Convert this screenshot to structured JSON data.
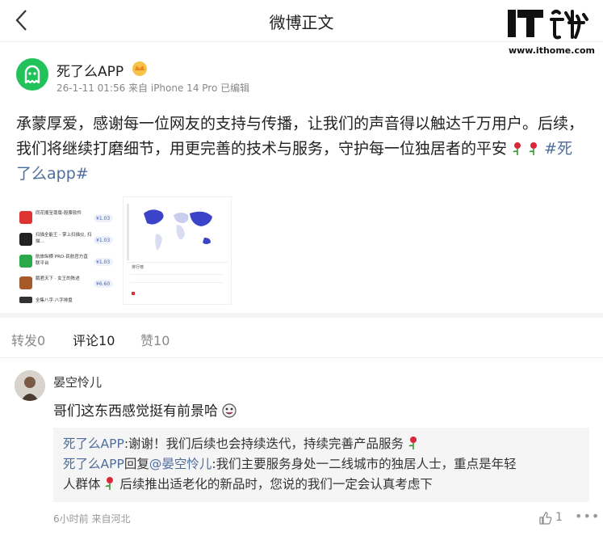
{
  "header": {
    "title": "微博正文",
    "brand_text": "IT之家",
    "brand_url": "www.ithome.com"
  },
  "post": {
    "author": "死了么APP",
    "meta": "26-1-11 01:56 来自 iPhone 14 Pro 已编辑",
    "text_main": "承蒙厚爱，感谢每一位网友的支持与传播，让我们的声音得以触达千万用户。后续，我们将继续打磨细节，用更完善的技术与服务，守护每一位独居者的平安",
    "hashtag": "#死了么app#",
    "images": [
      {
        "rows": [
          {
            "name": "同花顺至尊版-股票软件",
            "price": "¥1.03"
          },
          {
            "name": "扫描全能王 - 掌上扫描仪, 扫描...",
            "price": "¥1.03"
          },
          {
            "name": "航旅纵横 PRO-民航官方直联平台",
            "price": "¥1.03"
          },
          {
            "name": "鹅君天下 · 女王的陈述",
            "price": "¥6.60"
          },
          {
            "name": "全集八字·八字排盘",
            "price": ""
          }
        ]
      },
      {
        "panel_label": "排行榜"
      }
    ]
  },
  "tabs": [
    {
      "label": "转发",
      "count": "0"
    },
    {
      "label": "评论",
      "count": "10"
    },
    {
      "label": "赞",
      "count": "10"
    }
  ],
  "comment": {
    "author": "晏空怜儿",
    "text": "哥们这东西感觉挺有前景哈",
    "replies": {
      "r1_author": "死了么APP",
      "r1_text": ":谢谢！我们后续也会持续迭代，持续完善产品服务",
      "r2_author": "死了么APP",
      "r2_mid": "回复",
      "r2_mention": "@晏空怜儿",
      "r2_text_a": ":我们主要服务身处一二线城市的独居人士，重点是年轻",
      "r2_text_b": "人群体",
      "r2_text_c": " 后续推出适老化的新品时，您说的我们一定会认真考虑下"
    },
    "meta": "6小时前 来自河北",
    "likes": "1"
  },
  "icons": {
    "back": "chevron-left-icon",
    "crown": "crown-icon",
    "rose": "rose-icon",
    "like": "thumbs-up-icon",
    "more": "more-dots-icon"
  },
  "colors": {
    "link": "#4e6d9c",
    "brand_green": "#22c25a"
  }
}
